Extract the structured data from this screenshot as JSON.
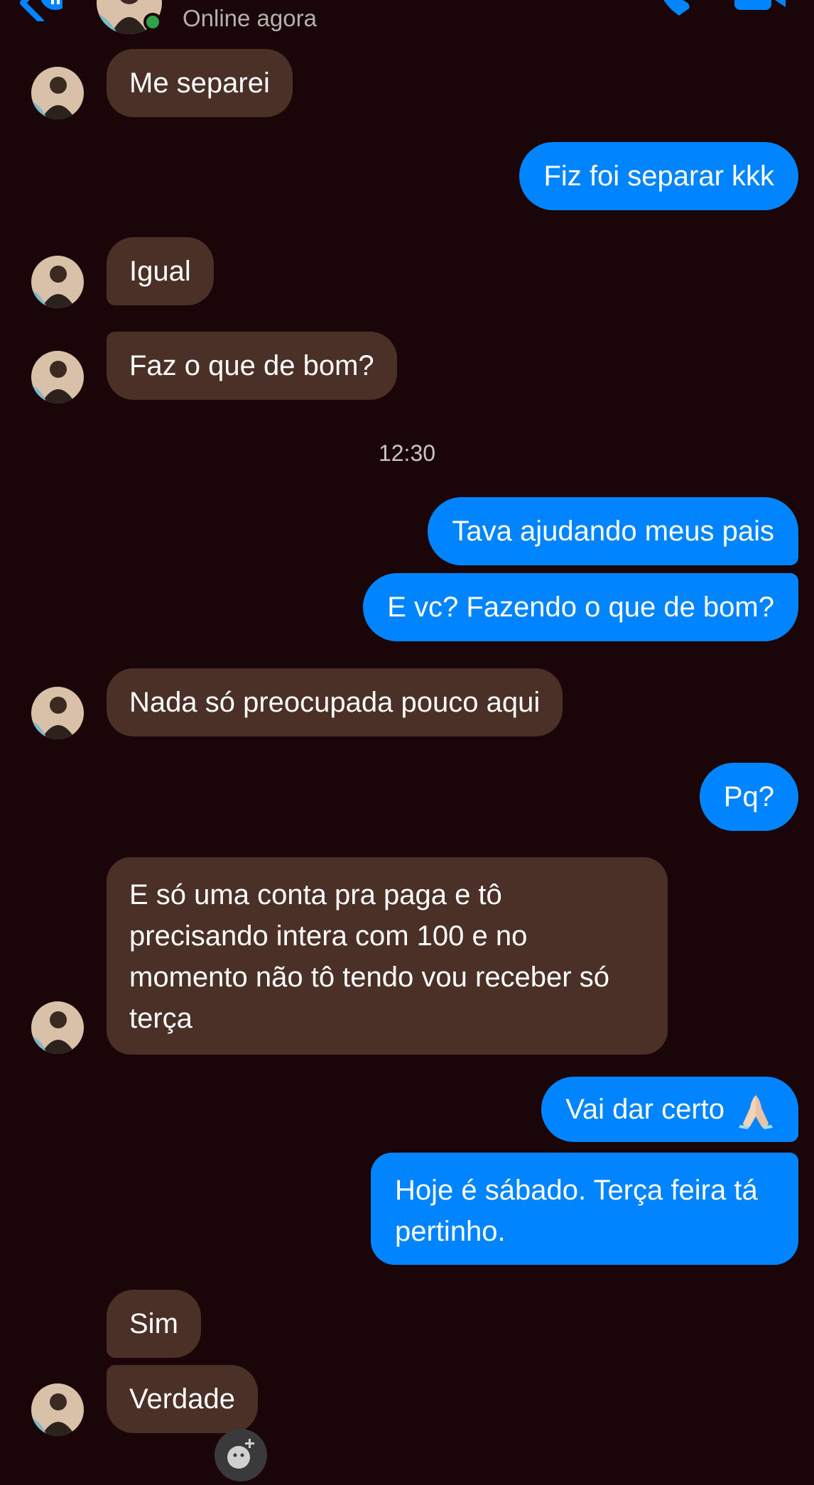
{
  "header": {
    "status": "Online agora",
    "online_color": "#31a24c",
    "icons": [
      "back-arrow-icon",
      "phone-icon",
      "video-camera-icon"
    ]
  },
  "colors": {
    "background": "#1a0608",
    "incoming_bubble": "#4a3026",
    "outgoing_bubble": "#0084ff",
    "text": "#ffffff"
  },
  "messages": [
    {
      "from": "them",
      "text": "Me separei"
    },
    {
      "from": "me",
      "text": "Fiz foi separar kkk"
    },
    {
      "from": "them",
      "text": "Igual"
    },
    {
      "from": "them",
      "text": "Faz o que de bom?"
    },
    {
      "from": "me",
      "text": "Tava ajudando meus pais"
    },
    {
      "from": "me",
      "text": "E vc? Fazendo o que de bom?"
    },
    {
      "from": "them",
      "text": "Nada só preocupada pouco aqui"
    },
    {
      "from": "me",
      "text": "Pq?"
    },
    {
      "from": "them",
      "text": "E só uma conta pra paga e tô precisando intera com 100 e no momento não tô tendo vou receber só terça"
    },
    {
      "from": "me",
      "text": "Vai dar certo",
      "emoji": "folded-hands-emoji"
    },
    {
      "from": "me",
      "text": "Hoje é sábado. Terça feira tá pertinho."
    },
    {
      "from": "them",
      "text": "Sim"
    },
    {
      "from": "them",
      "text": "Verdade"
    }
  ],
  "timestamp": "12:30"
}
